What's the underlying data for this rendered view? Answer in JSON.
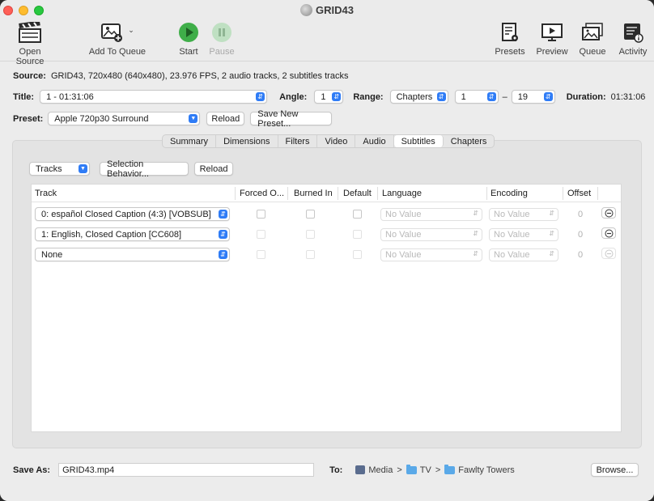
{
  "window": {
    "title": "GRID43"
  },
  "toolbar": {
    "open_source": "Open Source",
    "add_to_queue": "Add To Queue",
    "start": "Start",
    "pause": "Pause",
    "presets": "Presets",
    "preview": "Preview",
    "queue": "Queue",
    "activity": "Activity"
  },
  "source": {
    "label": "Source:",
    "value": "GRID43, 720x480 (640x480), 23.976 FPS, 2 audio tracks, 2 subtitles tracks"
  },
  "title_row": {
    "title_label": "Title:",
    "title_value": "1 - 01:31:06",
    "angle_label": "Angle:",
    "angle_value": "1",
    "range_label": "Range:",
    "range_type": "Chapters",
    "range_start": "1",
    "range_dash": "–",
    "range_end": "19",
    "duration_label": "Duration:",
    "duration_value": "01:31:06"
  },
  "preset": {
    "label": "Preset:",
    "value": "Apple 720p30 Surround",
    "reload": "Reload",
    "save_new": "Save New Preset..."
  },
  "tabs": [
    "Summary",
    "Dimensions",
    "Filters",
    "Video",
    "Audio",
    "Subtitles",
    "Chapters"
  ],
  "active_tab": "Subtitles",
  "subtitles": {
    "tracks_popup": "Tracks",
    "selection_behavior": "Selection Behavior...",
    "reload": "Reload",
    "columns": {
      "track": "Track",
      "forced": "Forced O...",
      "burned_in": "Burned In",
      "default": "Default",
      "language": "Language",
      "encoding": "Encoding",
      "offset": "Offset"
    },
    "rows": [
      {
        "track": "0: español Closed Caption (4:3) [VOBSUB]",
        "language": "No Value",
        "encoding": "No Value",
        "offset": "0"
      },
      {
        "track": "1: English, Closed Caption [CC608]",
        "language": "No Value",
        "encoding": "No Value",
        "offset": "0"
      },
      {
        "track": "None",
        "language": "No Value",
        "encoding": "No Value",
        "offset": "0"
      }
    ]
  },
  "save": {
    "label": "Save As:",
    "filename": "GRID43.mp4",
    "to_label": "To:",
    "path": [
      "Media",
      "TV",
      "Fawlty Towers"
    ],
    "separator": ">",
    "browse": "Browse..."
  },
  "colors": {
    "accent": "#2f7cf6",
    "start_green": "#3fae49"
  }
}
